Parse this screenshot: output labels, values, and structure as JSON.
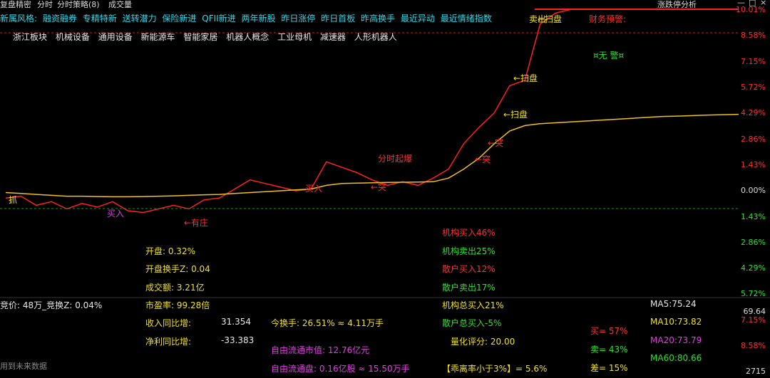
{
  "header": {
    "title_left": "复盘精密",
    "items": [
      "分时",
      "分时策略(8)",
      "成交量"
    ],
    "right_title": "涨跌停分析",
    "win_controls": [
      "—",
      "□",
      "×"
    ]
  },
  "tags_row": {
    "prefix": "新属风格:",
    "tags": [
      "融资融券",
      "专精特新",
      "送转潜力",
      "保险新进",
      "QFII新进",
      "两年新股",
      "昨日涨停",
      "昨日首板",
      "昨高换手",
      "最近异动",
      "最近情绪指数"
    ]
  },
  "sectors": [
    "浙江板块",
    "机械设备",
    "通用设备",
    "新能源车",
    "智能家居",
    "机器人概念",
    "工业母机",
    "减速器",
    "人形机器人"
  ],
  "price_axis": [
    "10.01%",
    "8.58%",
    "7.15%",
    "5.72%",
    "4.29%",
    "2.86%",
    "1.43%",
    "0.00%",
    "1.43%",
    "2.86%",
    "4.29%",
    "5.72%"
  ],
  "lower_axis": [
    "69.64",
    "7.15%",
    "8.58%",
    "2715"
  ],
  "chart_data": {
    "type": "line",
    "ylabel": "",
    "ylim": [
      -5.72,
      10.01
    ],
    "x": [
      0,
      5,
      10,
      15,
      20,
      25,
      30,
      35,
      40,
      45,
      50,
      55,
      60,
      65,
      70,
      75,
      80,
      85,
      90,
      95,
      100,
      105,
      110,
      115,
      120,
      125,
      130,
      135,
      140,
      145,
      150,
      155,
      160,
      165,
      170,
      175,
      180,
      185,
      190,
      195,
      200,
      205,
      210,
      215,
      220,
      225,
      230,
      235,
      240
    ],
    "series": [
      {
        "color": "#ff2020",
        "values": [
          -0.4,
          -0.3,
          -0.8,
          -0.6,
          -1.0,
          -0.7,
          -0.9,
          -0.6,
          -1.1,
          -1.2,
          -1.0,
          -0.8,
          -1.0,
          -0.5,
          -0.4,
          0.1,
          0.6,
          0.4,
          0.2,
          0.0,
          0.1,
          1.6,
          1.3,
          1.0,
          0.6,
          0.3,
          0.5,
          0.3,
          0.7,
          1.2,
          2.6,
          3.5,
          4.3,
          5.8,
          6.1,
          9.2,
          9.8,
          10.01,
          10.01,
          10.01,
          10.01,
          10.01,
          10.01,
          10.01,
          10.01,
          10.01,
          10.01,
          10.01,
          10.01
        ]
      },
      {
        "color": "#f0c020",
        "values": [
          -0.1,
          -0.15,
          -0.2,
          -0.25,
          -0.3,
          -0.3,
          -0.32,
          -0.33,
          -0.33,
          -0.32,
          -0.3,
          -0.28,
          -0.25,
          -0.22,
          -0.2,
          -0.15,
          -0.1,
          -0.05,
          0.0,
          0.05,
          0.1,
          0.3,
          0.4,
          0.42,
          0.44,
          0.46,
          0.47,
          0.48,
          0.5,
          0.7,
          1.2,
          1.8,
          2.6,
          3.3,
          3.6,
          3.7,
          3.75,
          3.8,
          3.85,
          3.9,
          3.95,
          4.0,
          4.05,
          4.1,
          4.12,
          4.15,
          4.18,
          4.2,
          4.22
        ]
      }
    ]
  },
  "annotations": {
    "fin_warning": "财务预警:",
    "no_warning": "¤无 警¤",
    "sweep1": "←扫盘",
    "sweep2": "←扫盘",
    "sweep3": "←扫盘",
    "sell": "卖出",
    "break": "←突",
    "break2": "←突",
    "break3": "←突",
    "buy": "买入",
    "surge": "分时起爆",
    "zhuang": "←有庄",
    "grab": "抓",
    "lower_buy": "买入"
  },
  "stats": {
    "open": "开盘:  0.32%",
    "open_turnover": "开盘换手Z:  0.04",
    "amount": "成交额:  3.21亿",
    "auction": "竞价: 48万_竞换Z:  0.04%",
    "pe": "市盈率:  99.28倍",
    "rev_yoy_label": "收入同比增:",
    "rev_yoy_val": "31.354",
    "profit_yoy_label": "净利同比增:",
    "profit_yoy_val": "-33.383",
    "turnover": "今换手:  26.51%  ≈  4.11万手",
    "float_cap": "自由流通市值:  12.76亿元",
    "float_shares": "自由流通盘:  0.16亿股  ≈  15.50万手",
    "inst_buy": "机构买入46%",
    "inst_sell": "机构卖出25%",
    "retail_buy": "散户买入12%",
    "retail_sell": "散户卖出17%",
    "inst_total_buy": "机构总买入21%",
    "retail_total_buy": "散户总买入-5%",
    "quant_score": "量化评分:  20.00",
    "deviation": "【乖离率小于3%】= 5.6%",
    "ma5": "MA5:75.24",
    "ma10": "MA10:73.82",
    "ma20": "MA20:73.79",
    "ma60": "MA60:80.66",
    "buy_pct": "买= 57%",
    "sell_pct": "卖= 43%",
    "diff_pct": "差= 15%",
    "footer": "用到未来数据"
  }
}
